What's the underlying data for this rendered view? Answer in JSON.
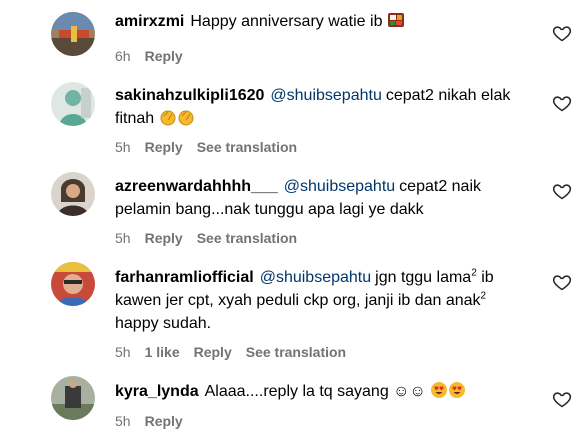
{
  "comments": [
    {
      "username": "amirxzmi",
      "mention": "",
      "lines": [
        "Happy anniversary watie ib"
      ],
      "emoji": "bento-icon",
      "time": "6h",
      "likes": "",
      "reply_label": "Reply",
      "translate_label": ""
    },
    {
      "username": "sakinahzulkipli1620",
      "mention": "@shuibsepahtu",
      "lines": [
        "cepat2 nikah elak",
        "fitnah"
      ],
      "emoji": "clapping-hands-icon",
      "time": "5h",
      "likes": "",
      "reply_label": "Reply",
      "translate_label": "See translation"
    },
    {
      "username": "azreenwardahhhh___",
      "mention": "@shuibsepahtu",
      "lines": [
        "cepat2 naik",
        "pelamin bang...nak tunggu apa lagi ye dakk"
      ],
      "emoji": "",
      "time": "5h",
      "likes": "",
      "reply_label": "Reply",
      "translate_label": "See translation"
    },
    {
      "username": "farhanramliofficial",
      "mention": "@shuibsepahtu",
      "lines": [
        "jgn tggu lama",
        "ib",
        "kawen jer cpt, xyah peduli ckp org, janji ib dan anak",
        "happy sudah."
      ],
      "sup": "2",
      "emoji": "",
      "time": "5h",
      "likes": "1 like",
      "reply_label": "Reply",
      "translate_label": "See translation"
    },
    {
      "username": "kyra_lynda",
      "mention": "",
      "lines": [
        "Alaaa....reply la tq sayang ☺☺"
      ],
      "emoji": "heart-eyes-icon",
      "time": "5h",
      "likes": "",
      "reply_label": "Reply",
      "translate_label": ""
    }
  ],
  "colors": {
    "mention": "#00376b",
    "meta": "#737373",
    "text": "#000000"
  }
}
